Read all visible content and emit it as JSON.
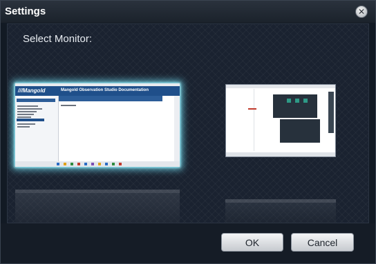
{
  "window": {
    "title": "Settings",
    "close_icon": "close-icon"
  },
  "content": {
    "heading": "Select Monitor:"
  },
  "monitors": [
    {
      "selected": true,
      "preview": {
        "logo": "///Mangold",
        "doc_title": "Mangold Observation Studio Documentation"
      }
    },
    {
      "selected": false
    }
  ],
  "footer": {
    "ok_label": "OK",
    "cancel_label": "Cancel"
  },
  "colors": {
    "selection_glow": "#78ebff",
    "title_bar": "#1b222b",
    "content_background": "#1a2230"
  }
}
